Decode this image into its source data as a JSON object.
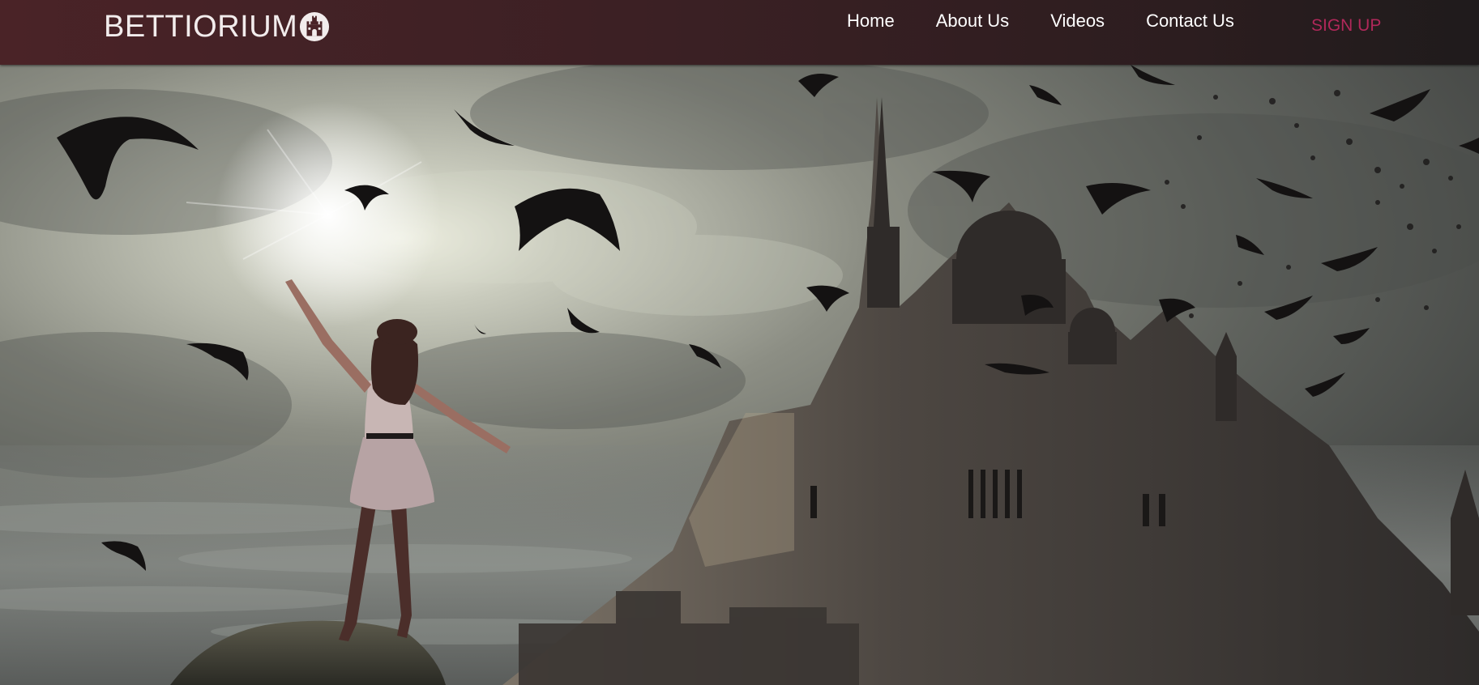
{
  "header": {
    "logo_text": "BETTIORIUM",
    "logo_icon": "castle-icon"
  },
  "nav": {
    "items": [
      {
        "label": "Home"
      },
      {
        "label": "About Us"
      },
      {
        "label": "Videos"
      },
      {
        "label": "Contact Us"
      }
    ],
    "signup_label": "SIGN UP"
  },
  "colors": {
    "header_bg": "#3b2024",
    "nav_text": "#ffffff",
    "signup_accent": "#b0285a"
  },
  "hero": {
    "description_icon": "fantasy-castle-scene"
  }
}
